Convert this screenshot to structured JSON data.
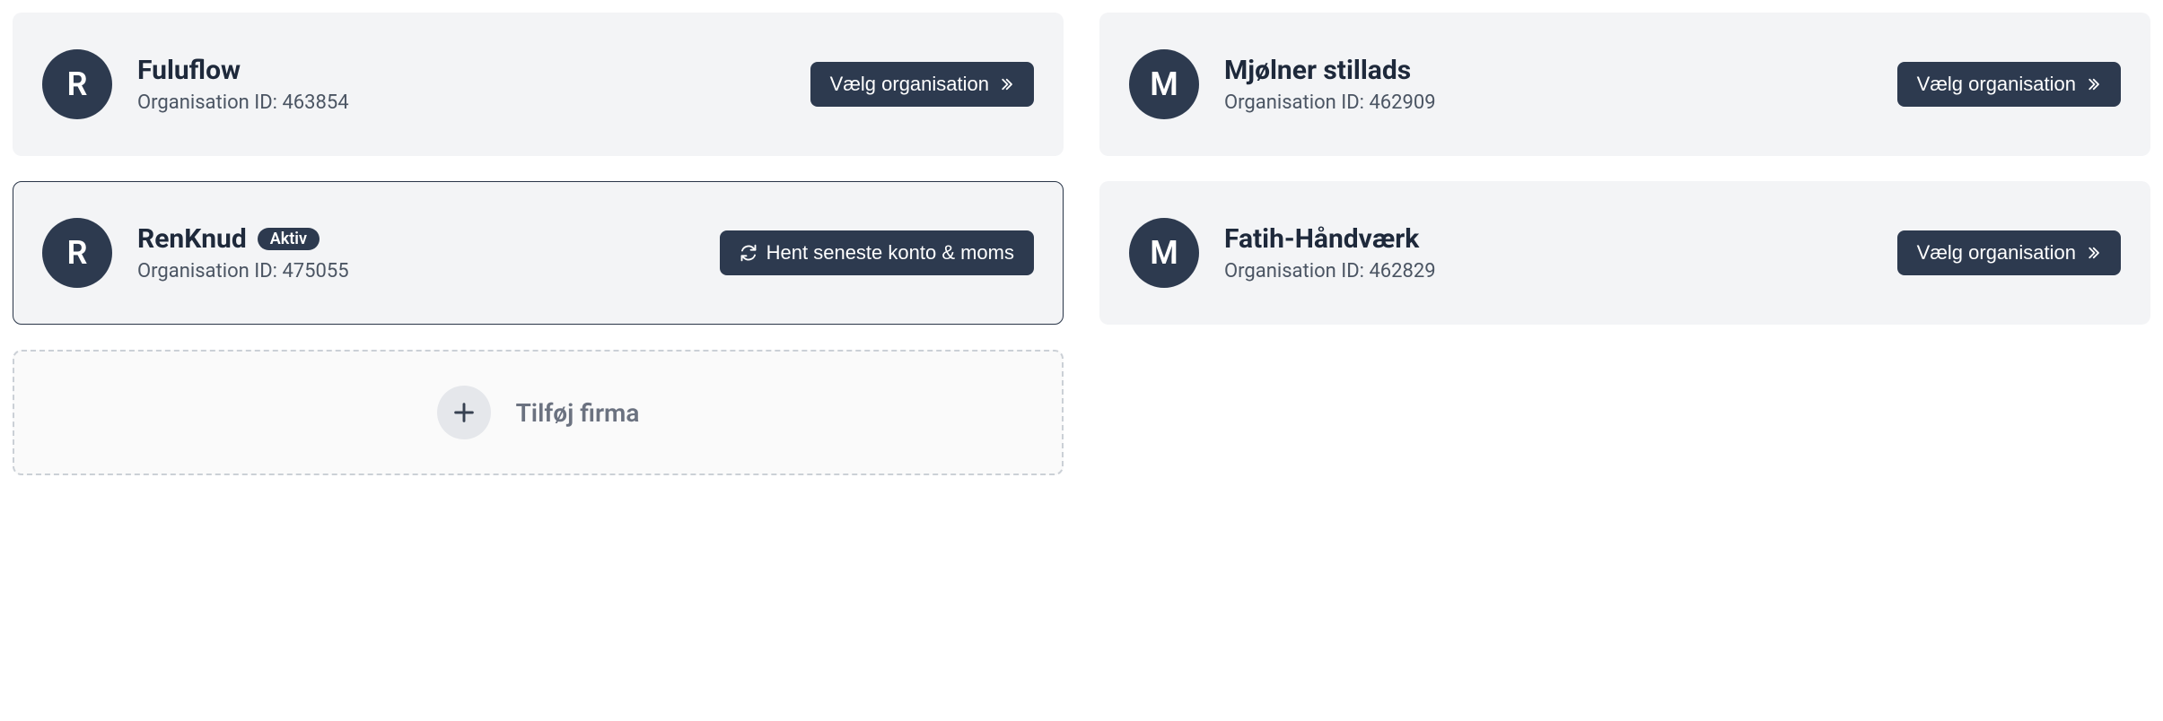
{
  "labels": {
    "select_org": "Vælg organisation",
    "fetch_latest": "Hent seneste konto & moms",
    "org_id_prefix": "Organisation ID: ",
    "add_company": "Tilføj firma",
    "active_badge": "Aktiv"
  },
  "cards": [
    {
      "initial": "R",
      "name": "Fuluflow",
      "org_id": "463854",
      "active": false
    },
    {
      "initial": "M",
      "name": "Mjølner stillads",
      "org_id": "462909",
      "active": false
    },
    {
      "initial": "R",
      "name": "RenKnud",
      "org_id": "475055",
      "active": true
    },
    {
      "initial": "M",
      "name": "Fatih-Håndværk",
      "org_id": "462829",
      "active": false
    }
  ]
}
